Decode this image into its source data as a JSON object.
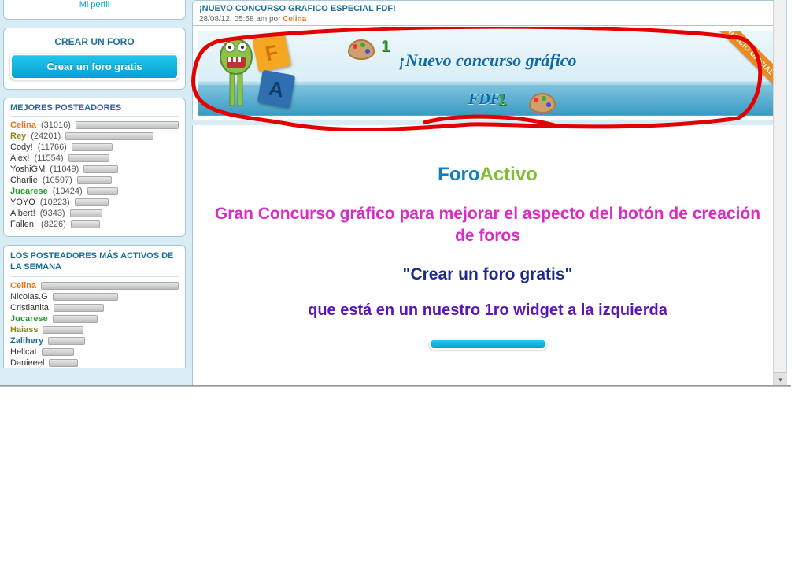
{
  "sidebar": {
    "profile_link": "Mi perfil",
    "create_title": "CREAR UN FORO",
    "create_button": "Crear un foro gratis",
    "top_posters_title": "MEJORES POSTEADORES",
    "top_posters": [
      {
        "name": "Celina",
        "count": "(31016)",
        "cls": "c-orange",
        "pct": 100
      },
      {
        "name": "Rey",
        "count": "(24201)",
        "cls": "c-olive",
        "pct": 78
      },
      {
        "name": "Cody!",
        "count": "(11766)",
        "cls": "c-plain",
        "pct": 38
      },
      {
        "name": "Alex!",
        "count": "(11554)",
        "cls": "c-plain",
        "pct": 37
      },
      {
        "name": "YoshiGM",
        "count": "(11049)",
        "cls": "c-plain",
        "pct": 36
      },
      {
        "name": "Charlie",
        "count": "(10597)",
        "cls": "c-plain",
        "pct": 34
      },
      {
        "name": "Jucarese",
        "count": "(10424)",
        "cls": "c-green",
        "pct": 34
      },
      {
        "name": "YOYO",
        "count": "(10223)",
        "cls": "c-plain",
        "pct": 33
      },
      {
        "name": "Albert!",
        "count": "(9343)",
        "cls": "c-plain",
        "pct": 30
      },
      {
        "name": "Fallen!",
        "count": "(8226)",
        "cls": "c-plain",
        "pct": 27
      }
    ],
    "week_posters_title": "LOS POSTEADORES MÁS ACTIVOS DE LA SEMANA",
    "week_posters": [
      {
        "name": "Celina",
        "cls": "c-orange",
        "pct": 100
      },
      {
        "name": "Nicolas.G",
        "cls": "c-plain",
        "pct": 52
      },
      {
        "name": "Cristianita",
        "cls": "c-plain",
        "pct": 40
      },
      {
        "name": "Jucarese",
        "cls": "c-green",
        "pct": 36
      },
      {
        "name": "Haiass",
        "cls": "c-olive",
        "pct": 30
      },
      {
        "name": "Zalihery",
        "cls": "c-blue",
        "pct": 28
      },
      {
        "name": "Hellcat",
        "cls": "c-plain",
        "pct": 24
      },
      {
        "name": "Danieeel",
        "cls": "c-plain",
        "pct": 22
      }
    ]
  },
  "topic": {
    "title": "¡NUEVO CONCURSO GRAFICO ESPECIAL FDF!",
    "meta_prefix": "28/08/12, 05:58 am por ",
    "author": "Celina"
  },
  "banner": {
    "line1": "¡Nuevo concurso gráfico",
    "line2": "FDF!",
    "ribbon": "ANUNCIO OFICIAL",
    "block_f": "F",
    "block_a": "A",
    "num1": "1",
    "num2": "1"
  },
  "post": {
    "logo_a": "Foro",
    "logo_b": "Activo",
    "pink": "Gran Concurso gráfico para mejorar el aspecto del botón de creación de foros",
    "navy": "\"Crear un foro gratis\"",
    "purple": "que está en un nuestro 1ro widget a la izquierda"
  }
}
